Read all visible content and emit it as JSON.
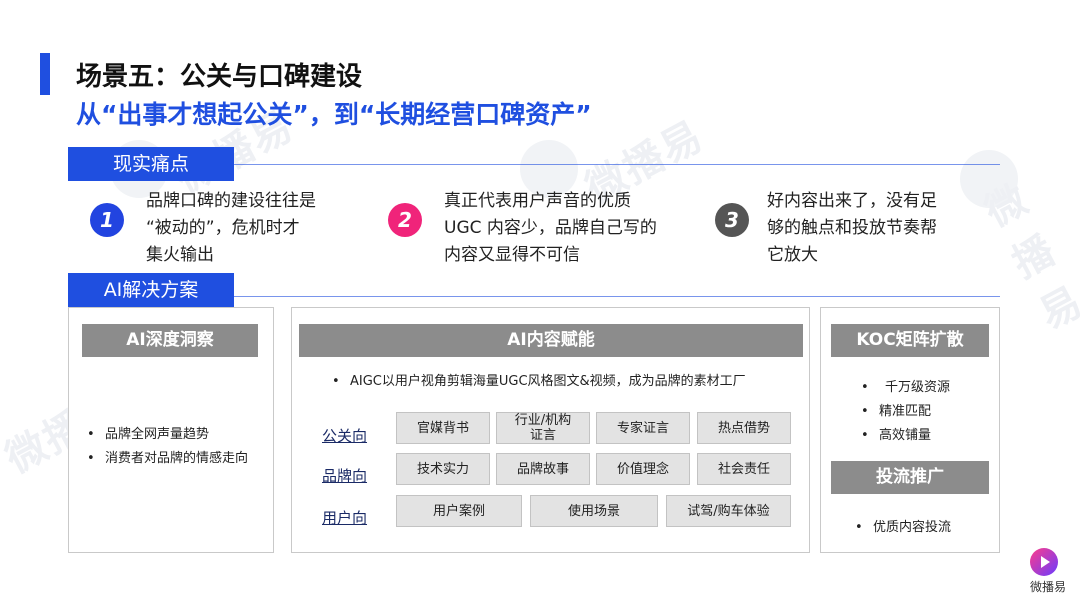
{
  "title": "场景五：公关与口碑建设",
  "subtitle": "从“出事才想起公关”，到“长期经营口碑资产”",
  "watermark": "微播易",
  "sections": {
    "pain_points": "现实痛点",
    "solution": "AI解决方案"
  },
  "pains": [
    {
      "num": "1",
      "color": "#2244e0",
      "lines": [
        "品牌口碑的建设往往是",
        "“被动的”，危机时才",
        "集火输出"
      ]
    },
    {
      "num": "2",
      "color": "#f0247a",
      "lines": [
        "真正代表用户声音的优质",
        "UGC 内容少，品牌自己写的",
        "内容又显得不可信"
      ]
    },
    {
      "num": "3",
      "color": "#555555",
      "lines": [
        "好内容出来了，没有足",
        "够的触点和投放节奏帮",
        "它放大"
      ]
    }
  ],
  "panels": {
    "insight": {
      "title": "AI深度洞察",
      "bullets": [
        "品牌全网声量趋势",
        "消费者对品牌的情感走向"
      ]
    },
    "content": {
      "title": "AI内容赋能",
      "bullet": "AIGC以用户视角剪辑海量UGC风格图文&视频，成为品牌的素材工厂",
      "rows": [
        {
          "label": "公关向",
          "tags": [
            "官媒背书",
            "行业/机构\n证言",
            "专家证言",
            "热点借势"
          ]
        },
        {
          "label": "品牌向",
          "tags": [
            "技术实力",
            "品牌故事",
            "价值理念",
            "社会责任"
          ]
        },
        {
          "label": "用户向",
          "tags": [
            "用户案例",
            "使用场景",
            "试驾/购车体验"
          ]
        }
      ]
    },
    "koc": {
      "title": "KOC矩阵扩散",
      "bullets": [
        "千万级资源",
        "精准匹配",
        "高效铺量"
      ],
      "sub_title": "投流推广",
      "sub_bullets": [
        "优质内容投流"
      ]
    }
  },
  "logo_text": "微播易"
}
